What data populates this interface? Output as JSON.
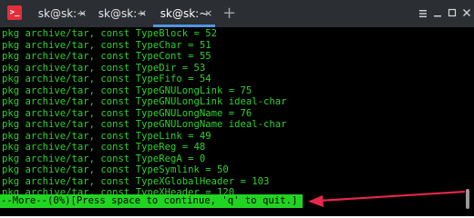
{
  "window": {
    "tabs": [
      {
        "label": "sk@sk:~",
        "close": "×"
      },
      {
        "label": "sk@sk:~",
        "close": "×"
      },
      {
        "label": "sk@sk:~",
        "close": "×"
      }
    ],
    "new_tab": "+",
    "app_icon": ">_",
    "icons": {
      "app": "terminal-icon",
      "menu": "menu-icon",
      "minimize": "minimize-icon",
      "maximize": "maximize-icon",
      "close": "close-icon"
    }
  },
  "terminal": {
    "lines": [
      "pkg archive/tar, const TypeBlock = 52",
      "pkg archive/tar, const TypeChar = 51",
      "pkg archive/tar, const TypeCont = 55",
      "pkg archive/tar, const TypeDir = 53",
      "pkg archive/tar, const TypeFifo = 54",
      "pkg archive/tar, const TypeGNULongLink = 75",
      "pkg archive/tar, const TypeGNULongLink ideal-char",
      "pkg archive/tar, const TypeGNULongName = 76",
      "pkg archive/tar, const TypeGNULongName ideal-char",
      "pkg archive/tar, const TypeLink = 49",
      "pkg archive/tar, const TypeReg = 48",
      "pkg archive/tar, const TypeRegA = 0",
      "pkg archive/tar, const TypeSymlink = 50",
      "pkg archive/tar, const TypeXGlobalHeader = 103",
      "pkg archive/tar, const TypeXHeader = 120"
    ],
    "more_prompt": "--More--(0%)[Press space to continue, 'q' to quit.]"
  },
  "colors": {
    "text": "#2fd12f",
    "prompt_bg": "#22d422",
    "annotation_arrow": "#e8274b",
    "titlebar": "#2b2e33",
    "active_tab_accent": "#5294e2"
  }
}
